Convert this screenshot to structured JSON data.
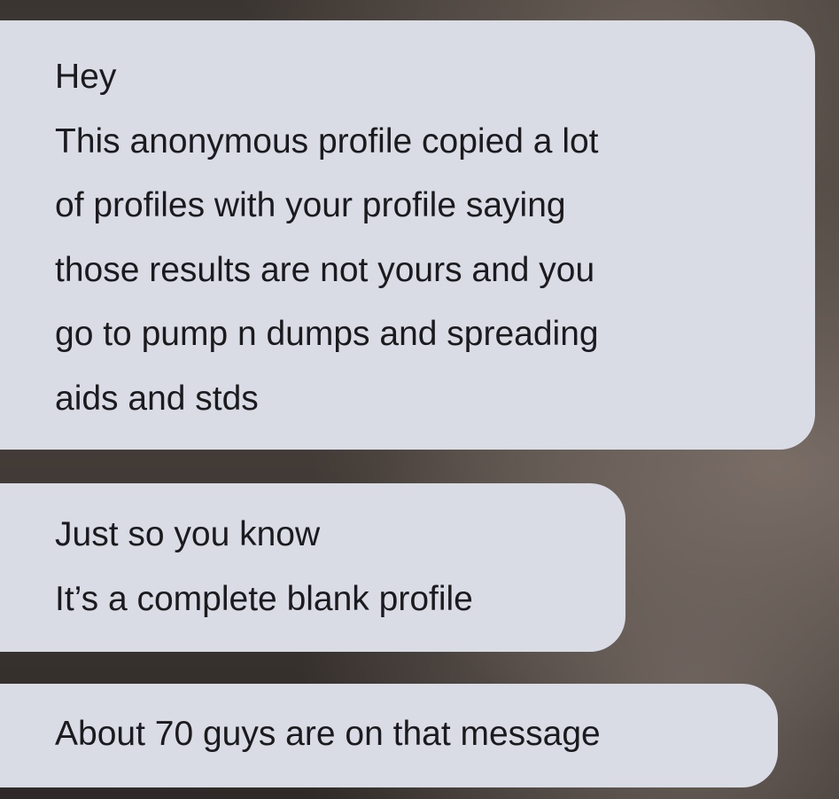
{
  "conversation": {
    "messages": [
      {
        "lines": [
          "Hey",
          "This anonymous profile copied a lot",
          "of profiles with your profile saying",
          "those results are not yours and you",
          "go to pump n dumps and spreading",
          "aids and stds"
        ]
      },
      {
        "lines": [
          "Just so you know",
          "It’s a complete blank profile"
        ]
      },
      {
        "lines": [
          "About 70 guys are on that message"
        ]
      }
    ]
  },
  "colors": {
    "bubble_background": "#d9dce5",
    "bubble_text": "#1b1b1f",
    "wallpaper": "#3b3531"
  }
}
